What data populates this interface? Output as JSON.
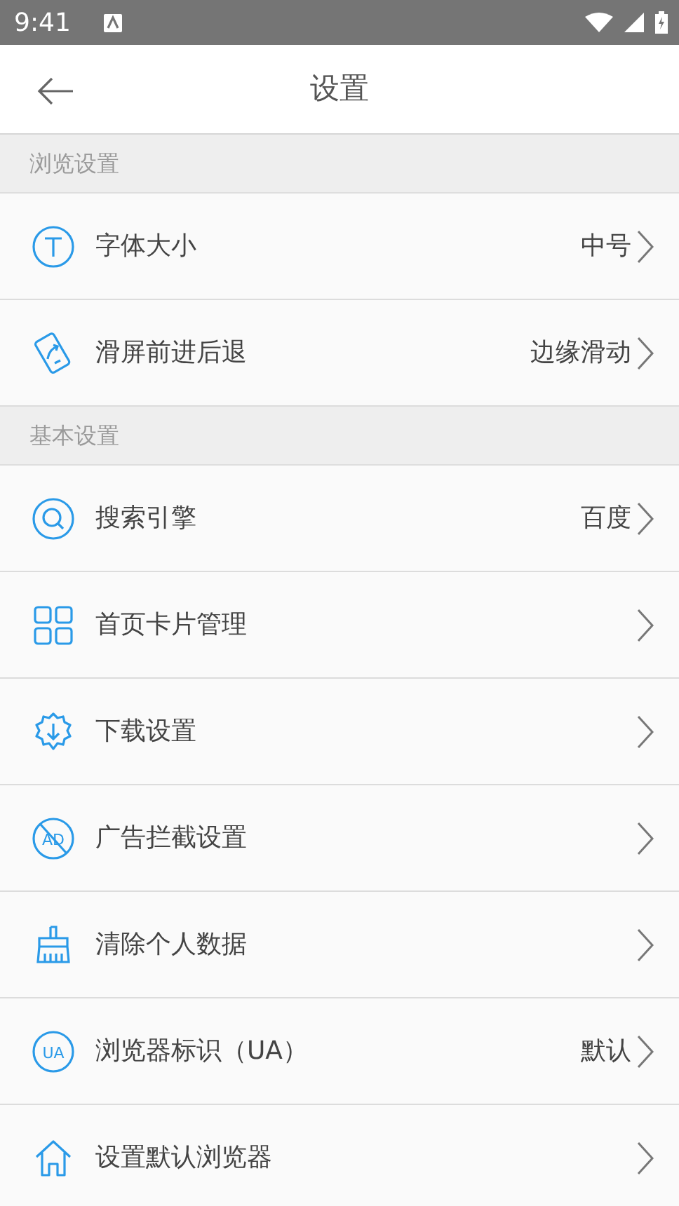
{
  "status_bar": {
    "time": "9:41"
  },
  "toolbar": {
    "title": "设置"
  },
  "sections": [
    {
      "title": "浏览设置",
      "items": [
        {
          "label": "字体大小",
          "value": "中号"
        },
        {
          "label": "滑屏前进后退",
          "value": "边缘滑动"
        }
      ]
    },
    {
      "title": "基本设置",
      "items": [
        {
          "label": "搜索引擎",
          "value": "百度"
        },
        {
          "label": "首页卡片管理"
        },
        {
          "label": "下载设置"
        },
        {
          "label": "广告拦截设置",
          "icon_text": "AD"
        },
        {
          "label": "清除个人数据"
        },
        {
          "label": "浏览器标识（UA）",
          "value": "默认",
          "icon_text": "UA"
        },
        {
          "label": "设置默认浏览器"
        }
      ]
    }
  ]
}
